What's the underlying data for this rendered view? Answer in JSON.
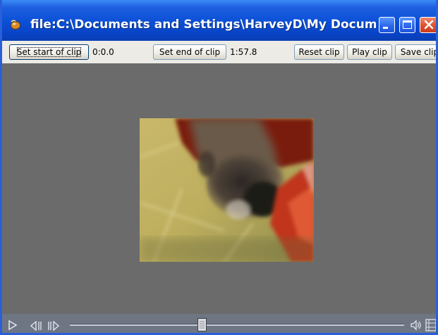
{
  "window": {
    "title": "file:C:\\Documents and Settings\\HarveyD\\My Documen..."
  },
  "toolbar": {
    "set_start_label": "Set start of clip",
    "start_time": "0:0.0",
    "set_end_label": "Set end of clip",
    "end_time": "1:57.8",
    "reset_label": "Reset clip",
    "play_label": "Play clip",
    "save_label": "Save clip"
  },
  "controls": {
    "play_icon": "play-icon",
    "step_back_icon": "step-back-icon",
    "step_forward_icon": "step-forward-icon",
    "volume_icon": "volume-icon",
    "film_icon": "film-icon",
    "seek_position_fraction": 0.38
  },
  "colors": {
    "titlebar": "#0a4fd6",
    "close": "#e0502d",
    "background": "#6b6b6b",
    "toolbar": "#ecebe6"
  }
}
